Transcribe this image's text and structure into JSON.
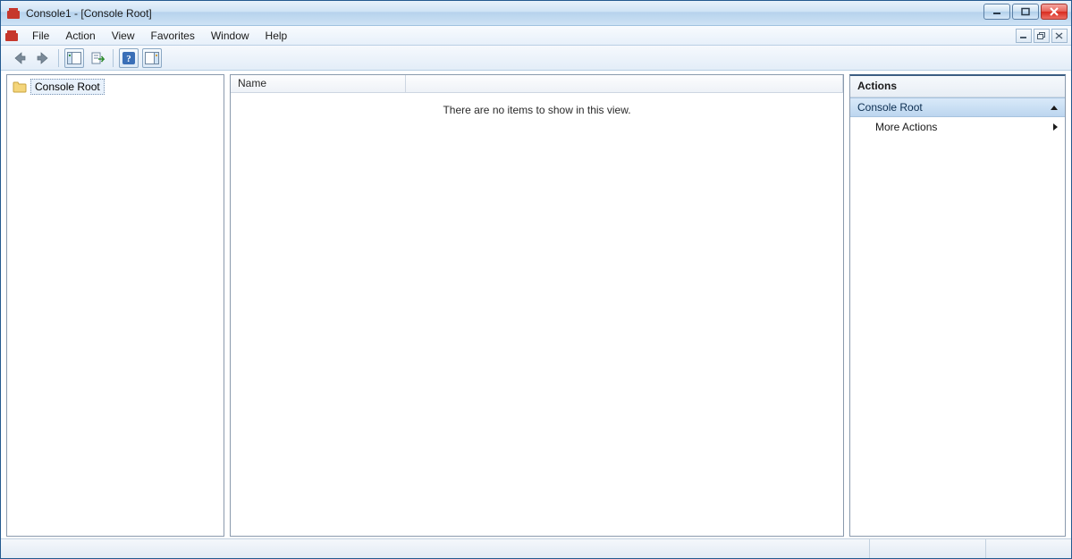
{
  "window": {
    "title": "Console1 - [Console Root]"
  },
  "menu": {
    "file": "File",
    "action": "Action",
    "view": "View",
    "favorites": "Favorites",
    "window": "Window",
    "help": "Help"
  },
  "toolbar": {
    "back": "back-icon",
    "forward": "forward-icon",
    "up": "show-hide-console-tree-icon",
    "export": "export-list-icon",
    "help": "help-icon",
    "actionpane": "show-hide-action-pane-icon"
  },
  "tree": {
    "root_label": "Console Root"
  },
  "list": {
    "columns": {
      "name": "Name"
    },
    "empty_message": "There are no items to show in this view."
  },
  "actions": {
    "title": "Actions",
    "group": "Console Root",
    "more": "More Actions"
  }
}
